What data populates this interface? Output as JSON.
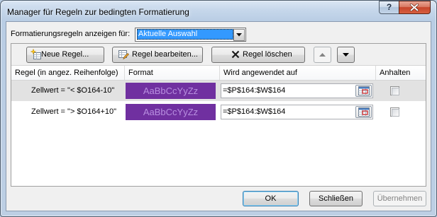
{
  "window": {
    "title": "Manager für Regeln zur bedingten Formatierung",
    "help_label": "?"
  },
  "filter": {
    "label": "Formatierungsregeln anzeigen für:",
    "selected": "Aktuelle Auswahl"
  },
  "toolbar": {
    "new_rule": "Neue Regel...",
    "edit_rule": "Regel bearbeiten...",
    "delete_rule": "Regel löschen",
    "move_up_enabled": false,
    "move_down_enabled": true
  },
  "table": {
    "columns": [
      "Regel (in angez. Reihenfolge)",
      "Format",
      "Wird angewendet auf",
      "Anhalten"
    ],
    "rows": [
      {
        "rule": "Zellwert = \"< $O164-10\"",
        "preview": "AaBbCcYyZz",
        "applies_to": "=$P$164:$W$164",
        "stop_if_true": false,
        "selected": true
      },
      {
        "rule": "Zellwert = \"> $O164+10\"",
        "preview": "AaBbCcYyZz",
        "applies_to": "=$P$164:$W$164",
        "stop_if_true": false,
        "selected": false
      }
    ]
  },
  "footer": {
    "ok": "OK",
    "close": "Schließen",
    "apply": "Übernehmen",
    "apply_enabled": false
  },
  "colors": {
    "format_fill": "#7030a0",
    "format_text": "#b88fe0",
    "row_selected": "#e2e2e2",
    "combo_highlight": "#3399ff",
    "close_button": "#c7452b"
  },
  "icons": {
    "help": "help-icon",
    "close": "close-icon",
    "dropdown": "chevron-down-icon",
    "new_rule": "new-rule-icon",
    "edit_rule": "edit-rule-icon",
    "delete_rule": "delete-x-icon",
    "move_up": "arrow-up-icon",
    "move_down": "arrow-down-icon",
    "range_picker": "collapse-dialog-icon"
  }
}
